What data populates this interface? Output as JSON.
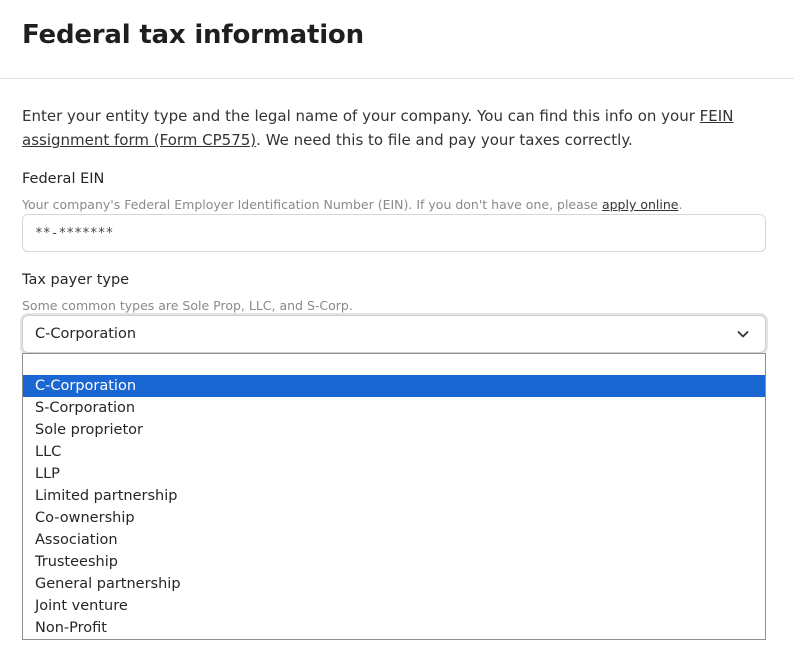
{
  "header": {
    "title": "Federal tax information"
  },
  "intro": {
    "text_before": "Enter your entity type and the legal name of your company. You can find this info on your ",
    "link_text": "FEIN assignment form (Form CP575)",
    "text_after": ". We need this to file and pay your taxes correctly."
  },
  "ein": {
    "label": "Federal EIN",
    "help_before": "Your company's Federal Employer Identification Number (EIN). If you don't have one, please ",
    "help_link": "apply online",
    "help_after": ".",
    "value": "**-*******"
  },
  "taxpayer": {
    "label": "Tax payer type",
    "help": "Some common types are Sole Prop, LLC, and S-Corp.",
    "selected": "C-Corporation",
    "options": [
      "C-Corporation",
      "S-Corporation",
      "Sole proprietor",
      "LLC",
      "LLP",
      "Limited partnership",
      "Co-ownership",
      "Association",
      "Trusteeship",
      "General partnership",
      "Joint venture",
      "Non-Profit"
    ],
    "selected_index": 0
  },
  "icons": {
    "select_toggle": "chevron-down-icon"
  },
  "colors": {
    "selected_option_bg": "#1a66d2",
    "help_text": "#8a8a8a"
  }
}
